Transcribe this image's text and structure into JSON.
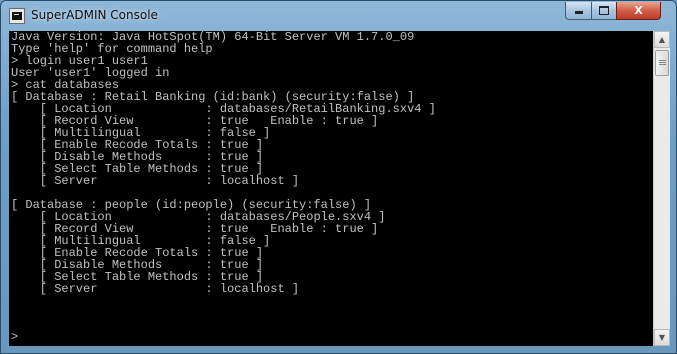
{
  "window": {
    "title": "SuperADMIN Console",
    "controls": {
      "minimize_icon": "minimize-icon",
      "maximize_icon": "maximize-icon",
      "close_label": "X"
    }
  },
  "console": {
    "lines": [
      "Java Version: Java HotSpot(TM) 64-Bit Server VM 1.7.0_09",
      "Type 'help' for command help",
      "> login user1 user1",
      "User 'user1' logged in",
      "> cat databases",
      "[ Database : Retail Banking (id:bank) (security:false) ]",
      "    [ Location             : databases/RetailBanking.sxv4 ]",
      "    [ Record View          : true   Enable : true ]",
      "    [ Multilingual         : false ]",
      "    [ Enable Recode Totals : true ]",
      "    [ Disable Methods      : true ]",
      "    [ Select Table Methods : true ]",
      "    [ Server               : localhost ]",
      "",
      "[ Database : people (id:people) (security:false) ]",
      "    [ Location             : databases/People.sxv4 ]",
      "    [ Record View          : true   Enable : true ]",
      "    [ Multilingual         : false ]",
      "    [ Enable Recode Totals : true ]",
      "    [ Disable Methods      : true ]",
      "    [ Select Table Methods : true ]",
      "    [ Server               : localhost ]",
      "",
      "",
      "",
      ">"
    ]
  },
  "colors": {
    "console_bg": "#000000",
    "console_fg": "#c0c0c0",
    "close_button": "#c0392b",
    "titlebar": "#8fb7d8"
  }
}
